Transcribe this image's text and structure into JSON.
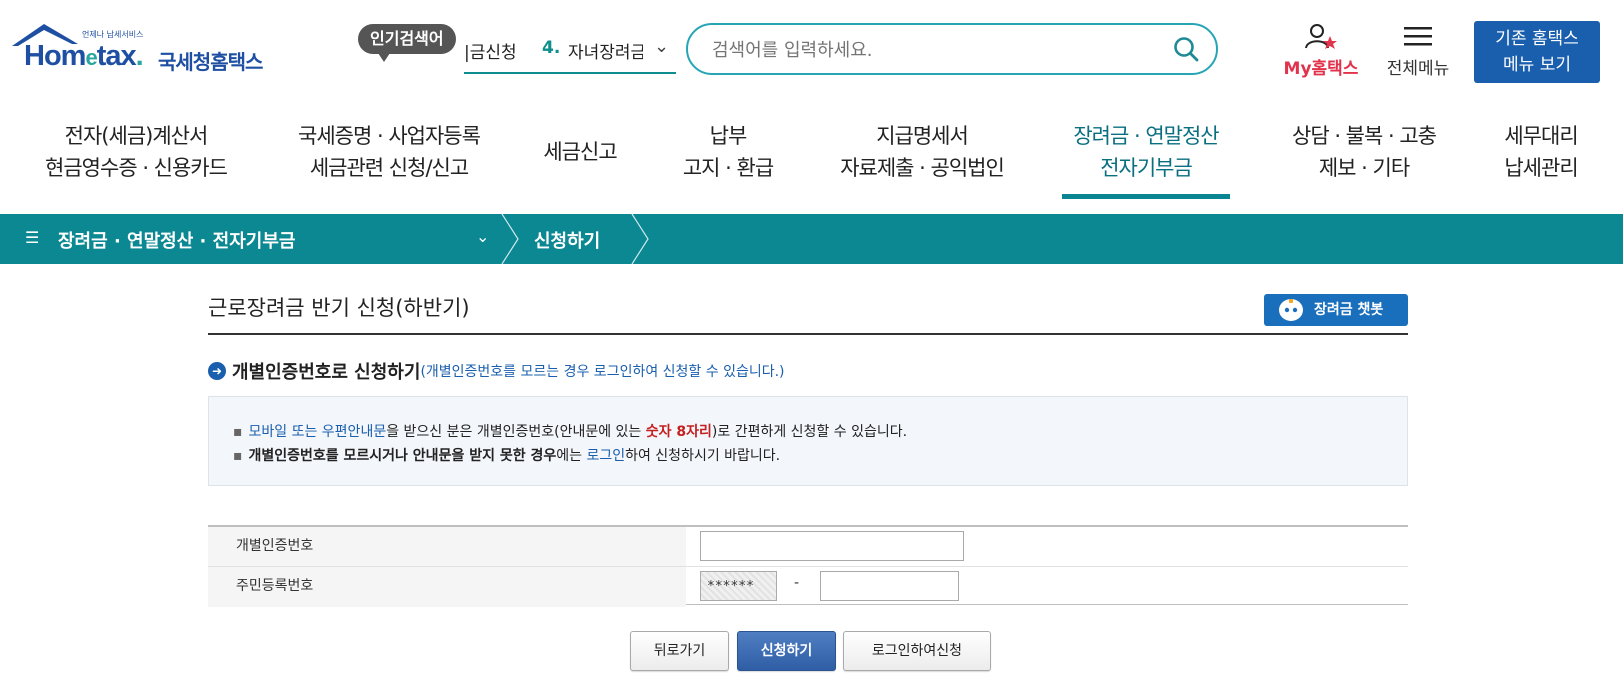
{
  "header": {
    "logo_sub": "언제나 납세서비스",
    "logo_main_a": "Hom",
    "logo_main_e": "e",
    "logo_main_b": "tax",
    "logo_dot": ".",
    "logo_kr": "국세청홈택스",
    "popular_badge": "인기검색어",
    "popular_prev": "|금신청",
    "popular_rank": "4.",
    "popular_item": "자녀장려금",
    "search_placeholder": "검색어를 입력하세요.",
    "my_hometax": "My홈택스",
    "all_menu": "전체메뉴",
    "old_menu_line1": "기존 홈택스",
    "old_menu_line2": "메뉴 보기"
  },
  "gnb": [
    {
      "line1": "전자(세금)계산서",
      "line2": "현금영수증 · 신용카드"
    },
    {
      "line1": "국세증명 · 사업자등록",
      "line2": "세금관련 신청/신고"
    },
    {
      "line1": "세금신고",
      "line2": ""
    },
    {
      "line1": "납부",
      "line2": "고지 · 환급"
    },
    {
      "line1": "지급명세서",
      "line2": "자료제출 · 공익법인"
    },
    {
      "line1": "장려금 · 연말정산",
      "line2": "전자기부금"
    },
    {
      "line1": "상담 · 불복 · 고충",
      "line2": "제보 · 기타"
    },
    {
      "line1": "세무대리",
      "line2": "납세관리"
    }
  ],
  "breadcrumb": {
    "crumb1": "장려금 · 연말정산 · 전자기부금",
    "crumb2": "신청하기"
  },
  "content": {
    "page_title": "근로장려금 반기 신청(하반기)",
    "chatbot_label": "장려금 챗봇",
    "section_title": "개별인증번호로 신청하기",
    "section_sub": "(개별인증번호를 모르는 경우 로그인하여 신청할 수 있습니다.)",
    "notice1_a": "모바일 또는 우편안내문",
    "notice1_b": "을 받으신 분은 개별인증번호(안내문에 있는 ",
    "notice1_c": "숫자 8자리",
    "notice1_d": ")로 간편하게 신청할 수 있습니다.",
    "notice2_a": "개별인증번호를 모르시거나 안내문을 받지 못한 경우",
    "notice2_b": "에는 ",
    "notice2_c": "로그인",
    "notice2_d": "하여 신청하시기 바랍니다.",
    "form": {
      "auth_label": "개별인증번호",
      "auth_value": "",
      "rrn_label": "주민등록번호",
      "rrn_front": "******",
      "rrn_dash": "-",
      "rrn_back": ""
    },
    "buttons": {
      "back": "뒤로가기",
      "apply": "신청하기",
      "login_apply": "로그인하여신청"
    }
  },
  "colors": {
    "teal_bar": "#0b8892",
    "brand_blue": "#1a5fae",
    "accent_red": "#e2324c"
  }
}
